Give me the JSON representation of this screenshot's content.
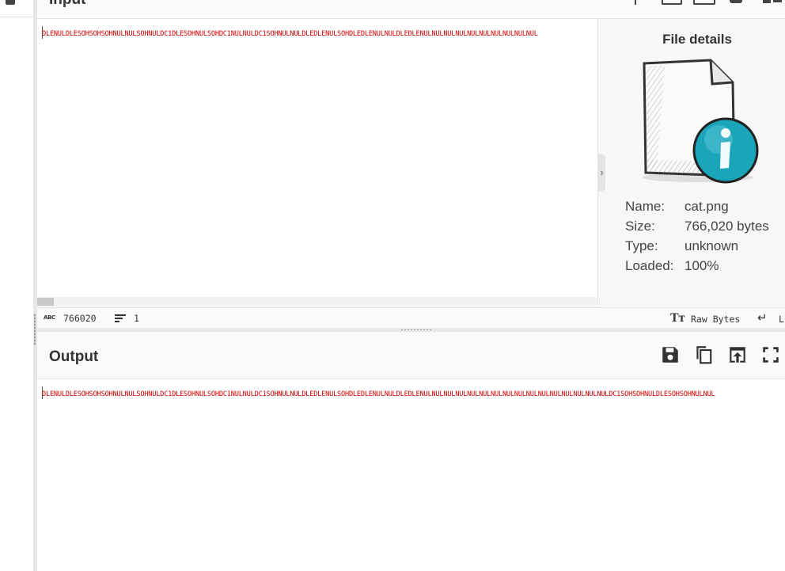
{
  "input": {
    "title": "Input",
    "data": "DLENULDLESOHSOHSOHNULNULSOHNULDC1DLESOHNULSOHDC1NULNULDC1SOHNULNULDLEDLENULSOHDLEDLENULNULDLEDLENULNULNULNULNULNULNULNULNULNUL"
  },
  "file_details": {
    "title": "File details",
    "name_label": "Name:",
    "name_value": "cat.png",
    "size_label": "Size:",
    "size_value": "766,020 bytes",
    "type_label": "Type:",
    "type_value": "unknown",
    "loaded_label": "Loaded:",
    "loaded_value": "100%",
    "toggle_glyph": "›"
  },
  "status": {
    "abc_glyph": "ABC",
    "length": "766020",
    "lines": "1",
    "chr_enc_glyph": "Tт",
    "chr_enc": "Raw Bytes",
    "eol_glyph": "↵",
    "eol": "LF"
  },
  "output": {
    "title": "Output",
    "data": "DLENULDLESOHSOHSOHNULNULSOHNULDC1DLESOHNULSOHDC1NULNULDC1SOHNULNULDLEDLENULSOHDLEDLENULNULDLEDLENULNULNULNULNULNULNULNULNULNULNULNULNULNULNULNULDC1SOHSOHNULDLESOHSOHNULNUL"
  },
  "icons": {
    "input": [
      "plus-icon",
      "open-folder-icon",
      "open-file-icon",
      "trash-icon",
      "layout-icon"
    ],
    "output": [
      "save-icon",
      "copy-icon",
      "switch-to-input-icon",
      "maximize-icon"
    ]
  },
  "colors": {
    "data_text": "#d40000",
    "icon_teal": "#1aa5b8"
  }
}
